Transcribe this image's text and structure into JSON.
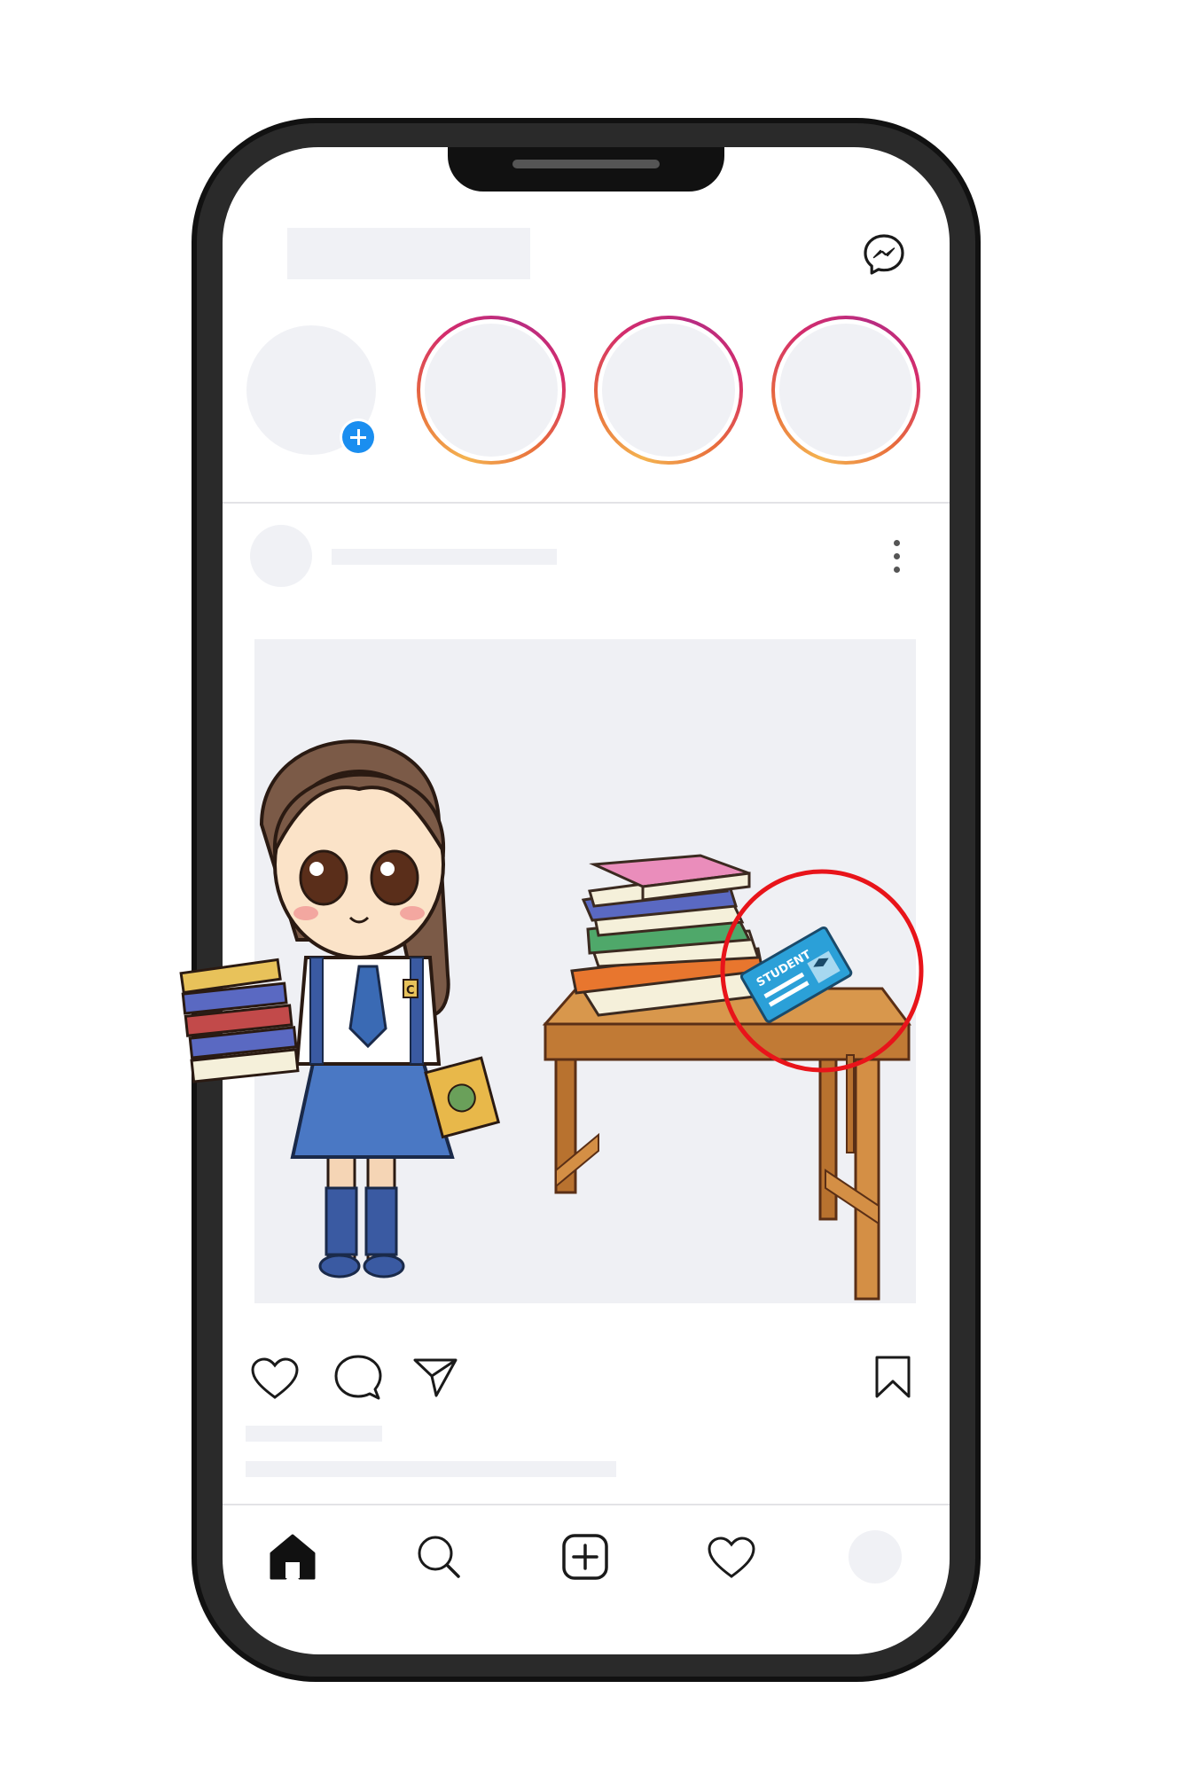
{
  "app": {
    "type": "social-feed-mockup",
    "accent_story_gradient": [
      "#f4b350",
      "#e86d3c",
      "#d42c6c",
      "#b82c82"
    ],
    "add_story_color": "#1a8ef0",
    "placeholder_color": "#f0f1f5"
  },
  "header": {
    "messenger_icon": "messenger-icon"
  },
  "stories": {
    "own_story": {
      "add_icon": "plus-icon"
    },
    "items": [
      {
        "ring": "gradient"
      },
      {
        "ring": "gradient"
      },
      {
        "ring": "gradient"
      }
    ]
  },
  "post": {
    "more_icon": "more-vertical-icon",
    "image": {
      "subject": "cartoon-schoolgirl-with-books",
      "highlight_circle_color": "#e8141a",
      "id_card_text": "STUDENT",
      "book_letter": "C"
    },
    "actions": {
      "like_icon": "heart-icon",
      "comment_icon": "comment-icon",
      "share_icon": "send-icon",
      "save_icon": "bookmark-icon"
    }
  },
  "bottom_nav": {
    "items": [
      "home-icon",
      "search-icon",
      "new-post-icon",
      "activity-heart-icon",
      "profile-avatar"
    ]
  }
}
